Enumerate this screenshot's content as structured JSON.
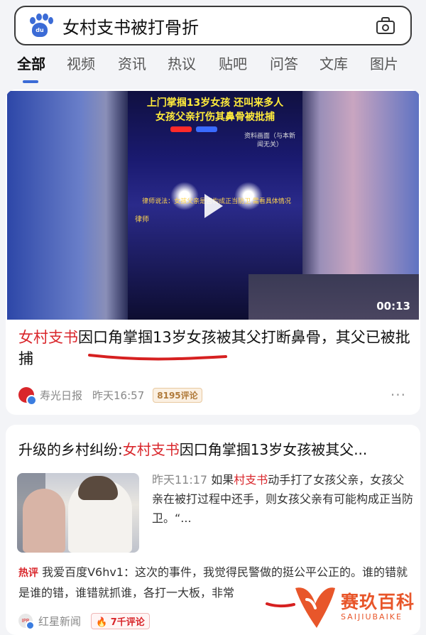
{
  "search": {
    "query": "女村支书被打骨折",
    "logo_text": "du"
  },
  "tabs": [
    "全部",
    "视频",
    "资讯",
    "热议",
    "贴吧",
    "问答",
    "文库",
    "图片"
  ],
  "result1": {
    "video": {
      "overlay_line1": "上门掌掴13岁女孩 还叫来多人",
      "overlay_line2": "女孩父亲打伤其鼻骨被批捕",
      "overlay_note": "资料画面（与本新闻无关）",
      "overlay_lawyer": "律师说法：女孩父亲是否构成正当防卫 需看具体情况",
      "overlay_tag": "律师",
      "duration": "00:13"
    },
    "headline_highlight": "女村支书",
    "headline_rest": "因口角掌掴13岁女孩被其父打断鼻骨，其父已被批捕",
    "source": "寿光日报",
    "time": "昨天16:57",
    "comments": "8195评论",
    "more": "···"
  },
  "result2": {
    "title_prefix": "升级的乡村纠纷:",
    "title_highlight": "女村支书",
    "title_rest": "因口角掌掴13岁女孩被其父...",
    "snippet_time": "昨天11:17",
    "snippet_pre": "如果",
    "snippet_highlight": "村支书",
    "snippet_post": "动手打了女孩父亲，女孩父亲在被打过程中还手，则女孩父亲有可能构成正当防卫。“...",
    "hot_tag": "热评",
    "hot_comment": "我爱百度V6hv1：这次的事件，我觉得民警做的挺公平公正的。谁的错就是谁的错，谁错就抓谁，各打一大板，非常",
    "source": "红星新闻",
    "source_logo": "IPR",
    "comments": "7千评论"
  },
  "watermark": {
    "title": "赛玖百科",
    "subtitle": "SAIJIUBAIKE"
  },
  "colors": {
    "highlight": "#d9262b",
    "accent": "#3b6bd6",
    "watermark": "#e8562a"
  }
}
